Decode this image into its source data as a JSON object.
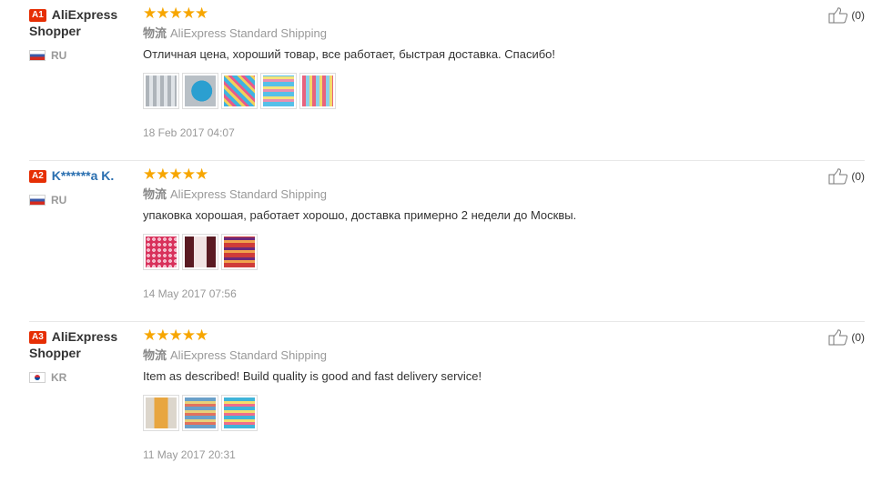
{
  "reviews": [
    {
      "badge": "A1",
      "username": "AliExpress Shopper",
      "country": "RU",
      "stars": "★★★★★",
      "shipping_cn": "物流",
      "shipping": "AliExpress Standard Shipping",
      "feedback": "Отличная цена, хороший товар, все работает, быстрая доставка. Спасибо!",
      "photos": [
        "p1",
        "p2",
        "p3",
        "p4",
        "p5"
      ],
      "date": "18 Feb 2017 04:07",
      "helpful_count": "(0)"
    },
    {
      "badge": "A2",
      "username": "K******a K.",
      "country": "RU",
      "stars": "★★★★★",
      "shipping_cn": "物流",
      "shipping": "AliExpress Standard Shipping",
      "feedback": "упаковка хорошая, работает хорошо, доставка примерно 2 недели до Москвы.",
      "photos": [
        "q1",
        "q2",
        "q3"
      ],
      "date": "14 May 2017 07:56",
      "helpful_count": "(0)"
    },
    {
      "badge": "A3",
      "username": "AliExpress Shopper",
      "country": "KR",
      "stars": "★★★★★",
      "shipping_cn": "物流",
      "shipping": "AliExpress Standard Shipping",
      "feedback": "Item as described! Build quality is good and fast delivery service!",
      "photos": [
        "r1",
        "r2",
        "r3"
      ],
      "date": "11 May 2017 20:31",
      "helpful_count": "(0)"
    }
  ],
  "colors": {
    "star": "#f7a600",
    "badge": "#e62e04",
    "link": "#2a6fb0"
  }
}
